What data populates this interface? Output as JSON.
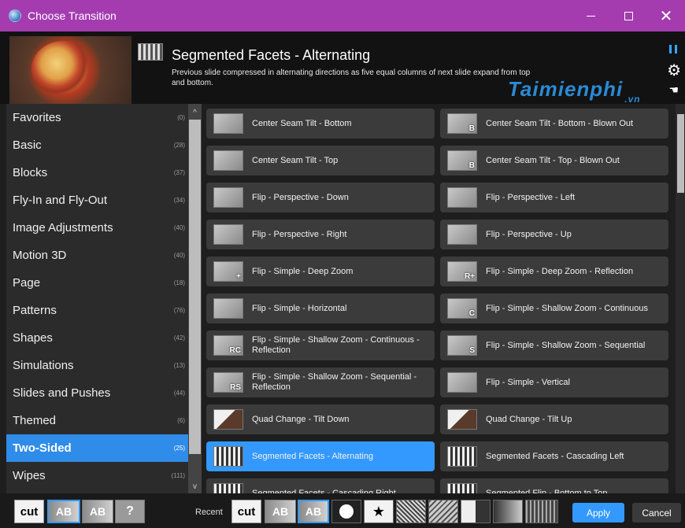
{
  "window": {
    "title": "Choose Transition",
    "minimize_glyph": "",
    "maximize_glyph": "",
    "close_glyph": "✕"
  },
  "header": {
    "transition_title": "Segmented Facets - Alternating",
    "transition_description": "Previous slide compressed in alternating directions as five equal columns of next slide expand from top and bottom.",
    "watermark": "Taimienphi",
    "watermark_suffix": ".vn",
    "gear_glyph": "⚙",
    "hand_glyph": "☚"
  },
  "sidebar": {
    "categories": [
      {
        "label": "Favorites",
        "count": "(0)"
      },
      {
        "label": "Basic",
        "count": "(28)"
      },
      {
        "label": "Blocks",
        "count": "(37)"
      },
      {
        "label": "Fly-In and Fly-Out",
        "count": "(34)"
      },
      {
        "label": "Image Adjustments",
        "count": "(40)"
      },
      {
        "label": "Motion 3D",
        "count": "(40)"
      },
      {
        "label": "Page",
        "count": "(18)"
      },
      {
        "label": "Patterns",
        "count": "(76)"
      },
      {
        "label": "Shapes",
        "count": "(42)"
      },
      {
        "label": "Simulations",
        "count": "(13)"
      },
      {
        "label": "Slides and Pushes",
        "count": "(44)"
      },
      {
        "label": "Themed",
        "count": "(6)"
      },
      {
        "label": "Two-Sided",
        "count": "(25)"
      },
      {
        "label": "Wipes",
        "count": "(111)"
      }
    ],
    "selected_index": 12,
    "scroll_up_glyph": "^",
    "scroll_down_glyph": "v"
  },
  "transitions": [
    {
      "label": "Center Seam Tilt - Bottom",
      "glyph": ""
    },
    {
      "label": "Center Seam Tilt - Bottom - Blown Out",
      "glyph": "B"
    },
    {
      "label": "Center Seam Tilt - Top",
      "glyph": ""
    },
    {
      "label": "Center Seam Tilt - Top - Blown Out",
      "glyph": "B"
    },
    {
      "label": "Flip - Perspective - Down",
      "glyph": ""
    },
    {
      "label": "Flip - Perspective - Left",
      "glyph": ""
    },
    {
      "label": "Flip - Perspective - Right",
      "glyph": ""
    },
    {
      "label": "Flip - Perspective - Up",
      "glyph": ""
    },
    {
      "label": "Flip - Simple - Deep Zoom",
      "glyph": "+"
    },
    {
      "label": "Flip - Simple - Deep Zoom - Reflection",
      "glyph": "R+"
    },
    {
      "label": "Flip - Simple - Horizontal",
      "glyph": ""
    },
    {
      "label": "Flip - Simple - Shallow Zoom - Continuous",
      "glyph": "C"
    },
    {
      "label": "Flip - Simple - Shallow Zoom - Continuous - Reflection",
      "glyph": "RC"
    },
    {
      "label": "Flip - Simple - Shallow Zoom - Sequential",
      "glyph": "S"
    },
    {
      "label": "Flip - Simple - Shallow Zoom - Sequential - Reflection",
      "glyph": "RS"
    },
    {
      "label": "Flip - Simple - Vertical",
      "glyph": ""
    },
    {
      "label": "Quad Change - Tilt Down",
      "glyph": ""
    },
    {
      "label": "Quad Change - Tilt Up",
      "glyph": ""
    },
    {
      "label": "Segmented Facets - Alternating",
      "glyph": ""
    },
    {
      "label": "Segmented Facets - Cascading Left",
      "glyph": ""
    },
    {
      "label": "Segmented Facets - Cascading Right",
      "glyph": ""
    },
    {
      "label": "Segmented Flip - Bottom to Top",
      "glyph": ""
    }
  ],
  "selected_transition_index": 18,
  "bottom": {
    "cut_label": "cut",
    "ab_label": "AB",
    "help_label": "?",
    "recent_label": "Recent",
    "star_glyph": "★",
    "apply_label": "Apply",
    "cancel_label": "Cancel"
  }
}
